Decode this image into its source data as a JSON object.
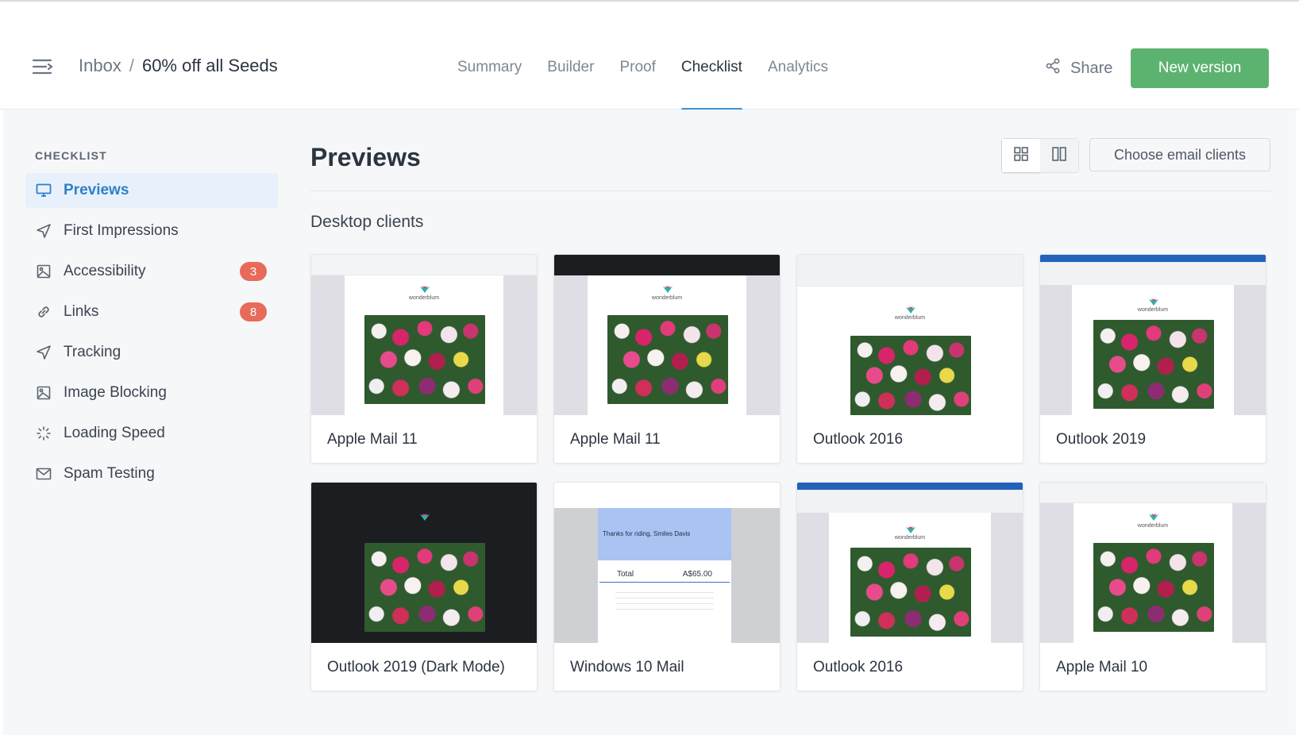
{
  "header": {
    "breadcrumb_root": "Inbox",
    "breadcrumb_separator": "/",
    "breadcrumb_current": "60% off all Seeds",
    "tabs": [
      "Summary",
      "Builder",
      "Proof",
      "Checklist",
      "Analytics"
    ],
    "active_tab": "Checklist",
    "share_label": "Share",
    "new_version_label": "New version"
  },
  "sidebar": {
    "heading": "CHECKLIST",
    "items": [
      {
        "label": "Previews",
        "icon": "monitor-icon",
        "badge": null,
        "active": true
      },
      {
        "label": "First Impressions",
        "icon": "send-icon",
        "badge": null
      },
      {
        "label": "Accessibility",
        "icon": "image-icon",
        "badge": "3"
      },
      {
        "label": "Links",
        "icon": "link-icon",
        "badge": "8"
      },
      {
        "label": "Tracking",
        "icon": "send-icon",
        "badge": null
      },
      {
        "label": "Image Blocking",
        "icon": "image-icon",
        "badge": null
      },
      {
        "label": "Loading Speed",
        "icon": "spinner-icon",
        "badge": null
      },
      {
        "label": "Spam Testing",
        "icon": "envelope-icon",
        "badge": null
      }
    ]
  },
  "main": {
    "title": "Previews",
    "choose_label": "Choose email clients",
    "section_title": "Desktop clients",
    "clients": [
      {
        "name": "Apple Mail 11",
        "style": "apple-light"
      },
      {
        "name": "Apple Mail 11",
        "style": "apple-dark-bar"
      },
      {
        "name": "Outlook 2016",
        "style": "outlook-ribbon"
      },
      {
        "name": "Outlook 2019",
        "style": "outlook-blue"
      },
      {
        "name": "Outlook 2019 (Dark Mode)",
        "style": "dark"
      },
      {
        "name": "Windows 10 Mail",
        "style": "receipt"
      },
      {
        "name": "Outlook 2016",
        "style": "outlook-blue"
      },
      {
        "name": "Apple Mail 10",
        "style": "apple-light"
      }
    ],
    "receipt": {
      "thanks": "Thanks for riding, Smiles Davis",
      "total_label": "Total",
      "total_value": "A$65.00"
    },
    "logo_text": "wonderblum"
  },
  "colors": {
    "accent": "#3b93d8",
    "primary_button": "#5cb370",
    "badge": "#e86a5a",
    "active_bg": "#e8f1fb"
  }
}
